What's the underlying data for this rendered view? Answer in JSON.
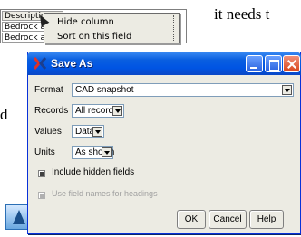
{
  "background": {
    "doc_text": "it needs t",
    "doc_side": "d",
    "table": {
      "header": "Description",
      "row1": "Bedrock at su",
      "row2": "Bedrock at ..."
    },
    "context_menu": {
      "hide": "Hide column",
      "sort": "Sort on this field"
    }
  },
  "dialog": {
    "title": "Save As",
    "format": {
      "label": "Format",
      "value": "CAD snapshot"
    },
    "records": {
      "label": "Records",
      "value": "All records"
    },
    "values": {
      "label": "Values",
      "value": "Data"
    },
    "units": {
      "label": "Units",
      "value": "As shown"
    },
    "include_hidden": "Include hidden fields",
    "use_field_names": "Use field names for headings",
    "buttons": {
      "ok": "OK",
      "cancel": "Cancel",
      "help": "Help"
    }
  }
}
